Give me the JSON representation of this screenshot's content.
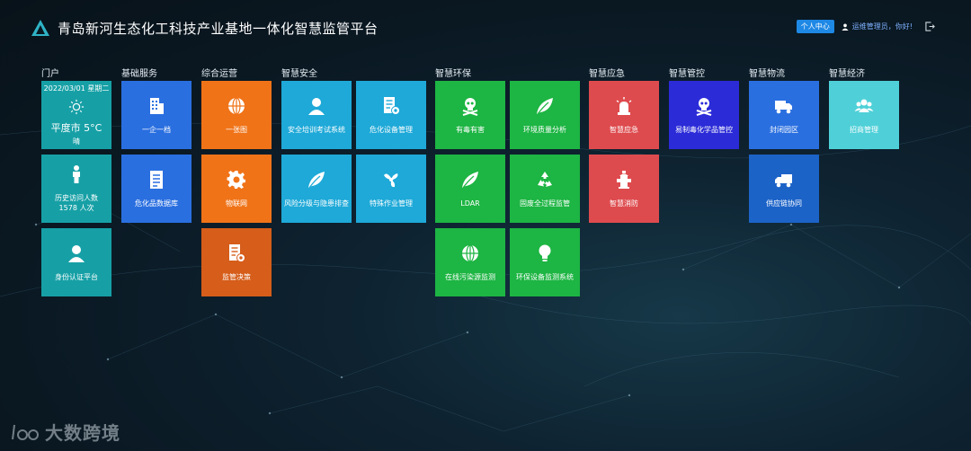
{
  "header": {
    "title": "青岛新河生态化工科技产业基地一体化智慧监管平台",
    "personal_center": "个人中心",
    "user_greeting": "运维管理员，你好!"
  },
  "columns": {
    "portal": "门户",
    "basic": "基础服务",
    "ops": "综合运营",
    "safety": "智慧安全",
    "env": "智慧环保",
    "emergency": "智慧应急",
    "control": "智慧管控",
    "logistics": "智慧物流",
    "economy": "智慧经济"
  },
  "portal": {
    "date": "2022/03/01 星期二",
    "temp": "平度市 5°C",
    "condition": "晴",
    "visit_label": "历史访问人数",
    "visit_count": "1578 人次",
    "identity": "身份认证平台"
  },
  "tiles": {
    "one_enterprise": "一企一档",
    "hazmat_db": "危化品数据库",
    "one_map": "一张图",
    "iot": "物联网",
    "decision": "监管决策",
    "training": "安全培训考试系统",
    "hazard_equip": "危化设备管理",
    "risk": "风险分级与隐患排查",
    "special_work": "特殊作业管理",
    "toxic": "有毒有害",
    "env_quality": "环境质量分析",
    "ldar": "LDAR",
    "solid_waste": "固废全过程监管",
    "online_pollution": "在线污染源监测",
    "env_equip": "环保设备监测系统",
    "smart_emergency": "智慧应急",
    "fire": "智慧消防",
    "precursor": "易制毒化学品管控",
    "closed_park": "封闭园区",
    "supply_chain": "供应链协同",
    "investment": "招商管理"
  },
  "watermark": "大数跨境",
  "colors": {
    "teal": "#16a0a6",
    "blue": "#2a6fe0",
    "orange": "#f07318",
    "dark_orange": "#d65d1a",
    "sky": "#1ea9d8",
    "green": "#1db543",
    "red": "#de4b4e",
    "indigo": "#2b2bd8",
    "cyan": "#4fd0d8"
  }
}
